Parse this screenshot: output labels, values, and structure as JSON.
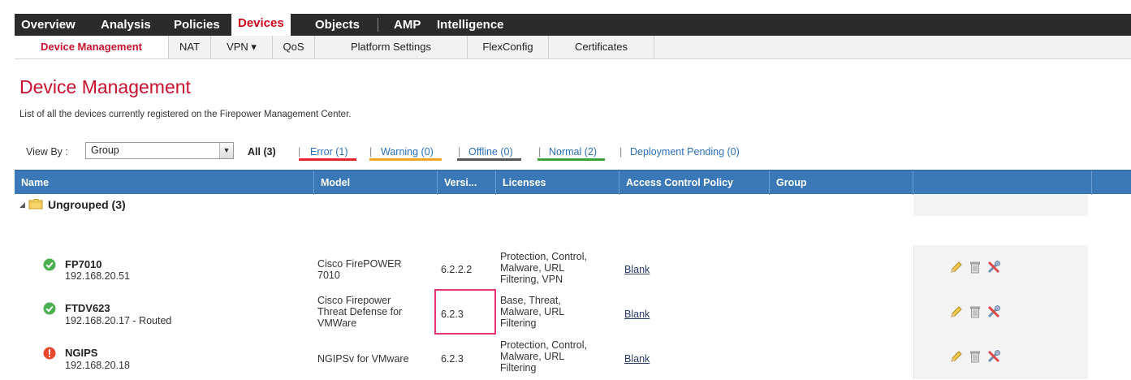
{
  "top_nav": {
    "items": [
      "Overview",
      "Analysis",
      "Policies",
      "Devices",
      "Objects",
      "AMP",
      "Intelligence"
    ],
    "active": "Devices"
  },
  "sub_nav": {
    "tabs": [
      "Device Management",
      "NAT",
      "VPN ▾",
      "QoS",
      "Platform Settings",
      "FlexConfig",
      "Certificates"
    ],
    "active": "Device Management"
  },
  "page": {
    "title": "Device Management",
    "description": "List of all the devices currently registered on the Firepower Management Center."
  },
  "view_by": {
    "label": "View By :",
    "selected": "Group"
  },
  "filters": {
    "all": "All (3)",
    "error": "Error (1)",
    "warning": "Warning (0)",
    "offline": "Offline (0)",
    "normal": "Normal (2)",
    "deployment_pending": "Deployment Pending (0)",
    "separator": "|"
  },
  "colors": {
    "error": "#e8232d",
    "warning": "#f5a623",
    "offline": "#555555",
    "normal": "#3aa335",
    "header_blue": "#3a78b8",
    "accent_red": "#c8102e",
    "highlight_pink": "#e8336b"
  },
  "table": {
    "columns": [
      "Name",
      "Model",
      "Versi...",
      "Licenses",
      "Access Control Policy",
      "Group"
    ],
    "group": {
      "label": "Ungrouped (3)",
      "icon": "folder-icon"
    },
    "rows": [
      {
        "status": "ok",
        "name": "FP7010",
        "ip": "192.168.20.51",
        "model_line1": "Cisco FirePOWER",
        "model_line2": "7010",
        "model_line3": "",
        "version": "6.2.2.2",
        "lic1": "Protection, Control,",
        "lic2": "Malware, URL",
        "lic3": "Filtering, VPN",
        "acp": "Blank",
        "group": ""
      },
      {
        "status": "ok",
        "name": "FTDV623",
        "ip": "192.168.20.17 - Routed",
        "model_line1": "Cisco Firepower",
        "model_line2": "Threat Defense for",
        "model_line3": "VMWare",
        "version": "6.2.3",
        "lic1": "Base, Threat,",
        "lic2": "Malware, URL",
        "lic3": "Filtering",
        "acp": "Blank",
        "group": ""
      },
      {
        "status": "error",
        "name": "NGIPS",
        "ip": "192.168.20.18",
        "model_line1": "NGIPSv for VMware",
        "model_line2": "",
        "model_line3": "",
        "version": "6.2.3",
        "lic1": "Protection, Control,",
        "lic2": "Malware, URL",
        "lic3": "Filtering",
        "acp": "Blank",
        "group": ""
      }
    ],
    "row_actions": [
      "pencil-edit-icon",
      "trash-delete-icon",
      "tools-troubleshoot-icon"
    ]
  }
}
